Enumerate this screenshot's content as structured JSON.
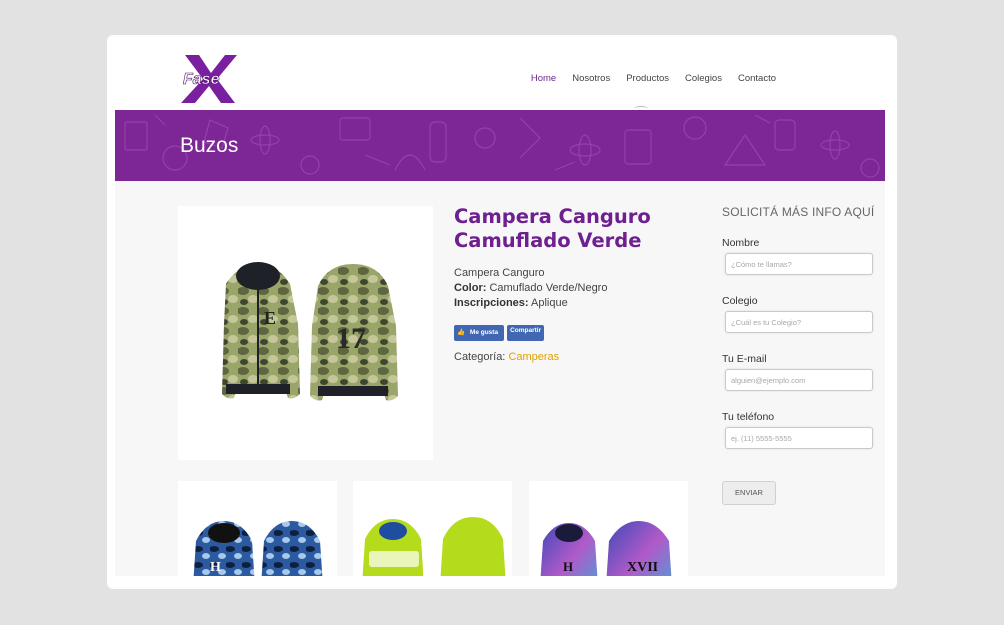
{
  "nav": {
    "items": [
      {
        "label": "Home",
        "active": true
      },
      {
        "label": "Nosotros",
        "active": false
      },
      {
        "label": "Productos",
        "active": false
      },
      {
        "label": "Colegios",
        "active": false
      },
      {
        "label": "Contacto",
        "active": false
      }
    ]
  },
  "logo": {
    "text": "Fase"
  },
  "banner": {
    "title": "Buzos"
  },
  "product": {
    "title": "Campera Canguro Camuflado Verde",
    "line1": "Campera Canguro",
    "color_label": "Color:",
    "color_value": "Camuflado Verde/Negro",
    "inscripciones_label": "Inscripciones:",
    "inscripciones_value": "Aplique",
    "like_label": "Me gusta",
    "share_label": "Compartir",
    "category_label": "Categoría:",
    "category_value": "Camperas",
    "main_image_text": "17"
  },
  "thumbnails": [
    {
      "name": "blue-camo-hoodie"
    },
    {
      "name": "lime-hoodie"
    },
    {
      "name": "galaxy-hoodie",
      "text": "XVII"
    }
  ],
  "form": {
    "heading": "SOLICITÁ MÁS INFO AQUÍ",
    "fields": [
      {
        "label": "Nombre",
        "placeholder": "¿Cómo te llamas?"
      },
      {
        "label": "Colegio",
        "placeholder": "¿Cuál es tu Colegio?"
      },
      {
        "label": "Tu E-mail",
        "placeholder": "alguien@ejemplo.com"
      },
      {
        "label": "Tu teléfono",
        "placeholder": "ej. (11) 5555-5555"
      }
    ],
    "submit_label": "ENVIAR"
  },
  "colors": {
    "brand_purple": "#7d2695",
    "title_purple": "#6e1f90",
    "link_gold": "#e0a200"
  }
}
